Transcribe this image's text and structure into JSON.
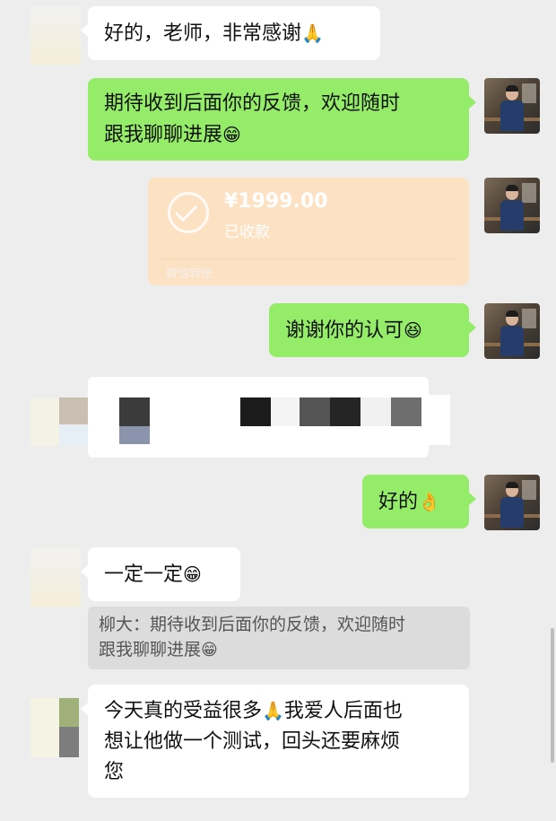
{
  "messages": {
    "m1": {
      "text": "好的，老师，非常感谢",
      "emoji": "🙏"
    },
    "m2": {
      "line1": "期待收到后面你的反馈，欢迎随时",
      "line2": "跟我聊聊进展",
      "emoji": "😁"
    },
    "transfer": {
      "amount": "¥1999.00",
      "status": "已收款",
      "source": "微信转账",
      "icon": "check-circle-icon"
    },
    "m4": {
      "text": "谢谢你的认可",
      "emoji": "😆"
    },
    "m6": {
      "text": "好的",
      "emoji": "👌"
    },
    "m7": {
      "text": "一定一定",
      "emoji": "😁"
    },
    "quote": {
      "line1": "柳大：期待收到后面你的反馈，欢迎随时",
      "line2": "跟我聊聊进展",
      "emoji": "😁"
    },
    "m8": {
      "line1": "今天真的受益很多",
      "emoji1": "🙏",
      "line1b": "我爱人后面也",
      "line2": "想让他做一个测试，回头还要麻烦",
      "line3": "您"
    }
  },
  "colors": {
    "background": "#ededed",
    "sent_bubble": "#95ec69",
    "received_bubble": "#ffffff",
    "transfer_card": "#fce1c2"
  }
}
